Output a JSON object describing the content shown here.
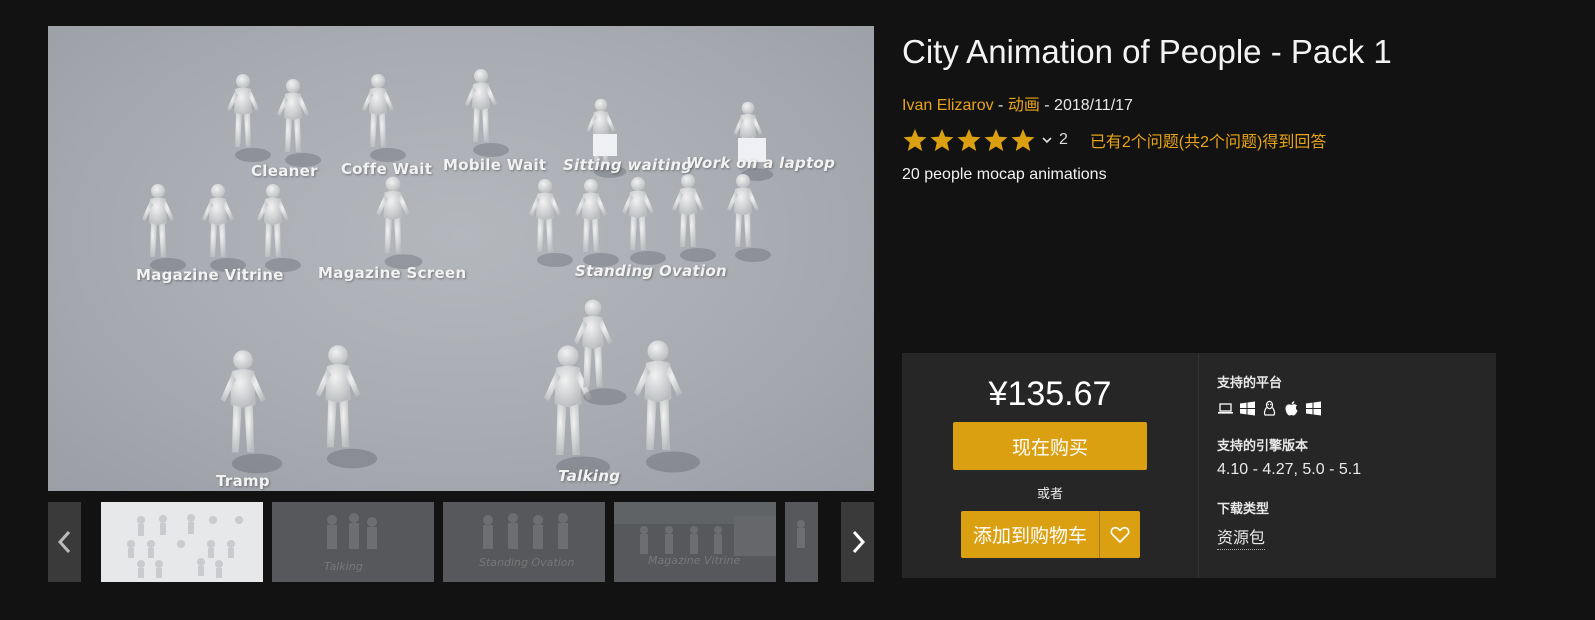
{
  "hero": {
    "labels": [
      "Cleaner",
      "Coffe Wait",
      "Mobile Wait",
      "Sitting waiting",
      "Work on a laptop",
      "Magazine Vitrine",
      "Magazine Screen",
      "Standing Ovation",
      "Tramp",
      "Talking"
    ]
  },
  "thumbnails": {
    "items": [
      {
        "label": ""
      },
      {
        "label": "Talking"
      },
      {
        "label": "Standing Ovation"
      },
      {
        "label": "Magazine Vitrine"
      },
      {
        "label": ""
      }
    ]
  },
  "product": {
    "title": "City Animation of People - Pack 1",
    "author": "Ivan Elizarov",
    "separator": " - ",
    "category": "动画",
    "date": "2018/11/17",
    "rating_value": 5,
    "rating_count": "2",
    "qa_text": "已有2个问题(共2个问题)得到回答",
    "short_description": "20 people mocap animations"
  },
  "purchase": {
    "price": "¥135.67",
    "buy_now_label": "现在购买",
    "or_label": "或者",
    "add_to_cart_label": "添加到购物车"
  },
  "specs": {
    "platforms_heading": "支持的平台",
    "platform_icons": [
      "laptop-icon",
      "windows-icon",
      "linux-icon",
      "apple-icon",
      "windows-icon"
    ],
    "engine_heading": "支持的引擎版本",
    "engine_versions": "4.10 - 4.27, 5.0 - 5.1",
    "download_heading": "下载类型",
    "download_type": "资源包"
  },
  "colors": {
    "accent": "#dba011",
    "link": "#e8a417",
    "background": "#121212",
    "panel": "#262626"
  }
}
